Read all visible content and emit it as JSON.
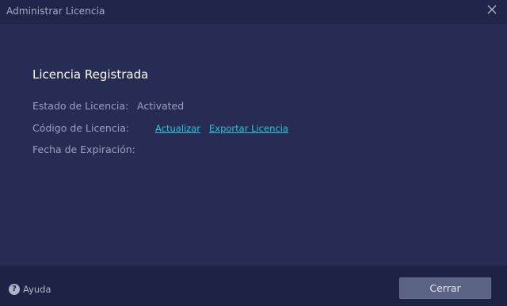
{
  "window": {
    "title": "Administrar Licencia",
    "close_icon": "close-icon"
  },
  "license": {
    "heading": "Licencia Registrada",
    "status_label": "Estado de Licencia:",
    "status_value": "Activated",
    "code_label": "Código de Licencia:",
    "update_link": "Actualizar",
    "export_link": "Exportar Licencia",
    "expiry_label": "Fecha de Expiración:"
  },
  "footer": {
    "help_icon": "help-icon",
    "help_label": "Ayuda",
    "close_button": "Cerrar"
  },
  "colors": {
    "background": "#252b51",
    "titlebar": "#20264a",
    "footer": "#1d2344",
    "link": "#27c5d9",
    "button": "#5b6385"
  }
}
